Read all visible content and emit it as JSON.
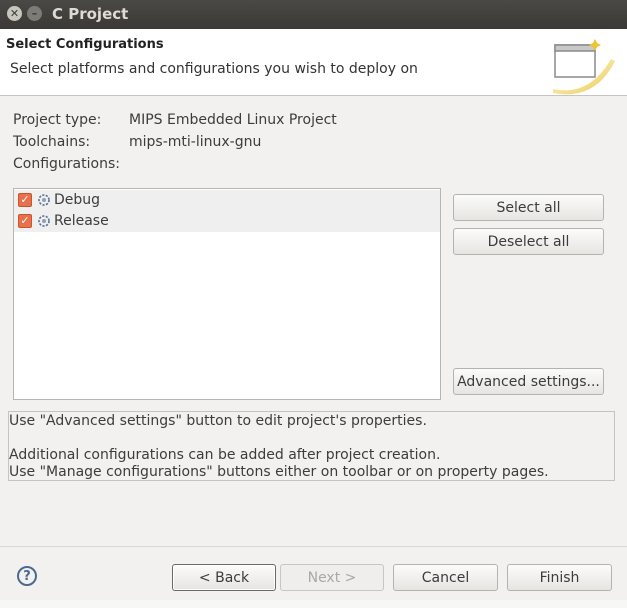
{
  "window": {
    "title": "C Project"
  },
  "header": {
    "title": "Select Configurations",
    "subtitle": "Select platforms and configurations you wish to deploy on",
    "icon": "wizard-banner-icon"
  },
  "project": {
    "type_label": "Project type:",
    "type_value": "MIPS Embedded Linux Project",
    "toolchains_label": "Toolchains:",
    "toolchains_value": "mips-mti-linux-gnu",
    "configurations_label": "Configurations:"
  },
  "configurations": [
    {
      "label": "Debug",
      "checked": true
    },
    {
      "label": "Release",
      "checked": true
    }
  ],
  "buttons": {
    "select_all": "Select all",
    "deselect_all": "Deselect all",
    "advanced": "Advanced settings...",
    "back": "< Back",
    "next": "Next >",
    "cancel": "Cancel",
    "finish": "Finish"
  },
  "info": {
    "line1": "Use \"Advanced settings\" button to edit project's properties.",
    "line2": "Additional configurations can be added after project creation.",
    "line3": "Use \"Manage configurations\" buttons either on toolbar or on property pages."
  },
  "colors": {
    "titlebar": "#3c3b37",
    "checkbox_accent": "#e8704a",
    "help_icon": "#4a6a92"
  }
}
